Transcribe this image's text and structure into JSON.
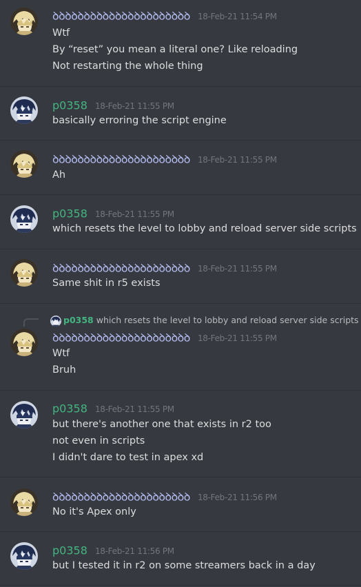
{
  "users": {
    "u1": {
      "name": "ꝺꝺꝺꝺꝺꝺꝺꝺꝺꝺꝺꝺꝺꝺꝺꝺꝺꝺꝺꝺꝺꝺ",
      "color": "#b7bff5",
      "avatar_icon": "golden-hair-avatar-icon"
    },
    "u2": {
      "name": "p0358",
      "color": "#43b581",
      "avatar_icon": "dark-hair-avatar-icon"
    }
  },
  "messages": [
    {
      "author": "ꝺꝺꝺꝺꝺꝺꝺꝺꝺꝺꝺꝺꝺꝺꝺꝺꝺꝺꝺꝺꝺꝺ",
      "timestamp": "18-Feb-21 11:54 PM",
      "lines": [
        "Wtf",
        "By “reset” you mean a literal one? Like reloading",
        "Not restarting the whole thing"
      ]
    },
    {
      "author": "p0358",
      "timestamp": "18-Feb-21 11:55 PM",
      "lines": [
        "basically erroring the script engine"
      ]
    },
    {
      "author": "ꝺꝺꝺꝺꝺꝺꝺꝺꝺꝺꝺꝺꝺꝺꝺꝺꝺꝺꝺꝺꝺꝺ",
      "timestamp": "18-Feb-21 11:55 PM",
      "lines": [
        "Ah"
      ]
    },
    {
      "author": "p0358",
      "timestamp": "18-Feb-21 11:55 PM",
      "lines": [
        "which resets the level to lobby and reload server side scripts"
      ]
    },
    {
      "author": "ꝺꝺꝺꝺꝺꝺꝺꝺꝺꝺꝺꝺꝺꝺꝺꝺꝺꝺꝺꝺꝺꝺ",
      "timestamp": "18-Feb-21 11:55 PM",
      "lines": [
        "Same shit in r5 exists"
      ]
    },
    {
      "reply": {
        "author": "p0358",
        "text": "which resets the level to lobby and reload server side scripts"
      },
      "author": "ꝺꝺꝺꝺꝺꝺꝺꝺꝺꝺꝺꝺꝺꝺꝺꝺꝺꝺꝺꝺꝺꝺ",
      "timestamp": "18-Feb-21 11:55 PM",
      "lines": [
        "Wtf",
        "Bruh"
      ]
    },
    {
      "author": "p0358",
      "timestamp": "18-Feb-21 11:55 PM",
      "lines": [
        "but there's another one that exists in r2 too",
        "not even in scripts",
        "I didn't dare to test in apex xd"
      ]
    },
    {
      "author": "ꝺꝺꝺꝺꝺꝺꝺꝺꝺꝺꝺꝺꝺꝺꝺꝺꝺꝺꝺꝺꝺꝺ",
      "timestamp": "18-Feb-21 11:56 PM",
      "lines": [
        "No it's Apex only"
      ]
    },
    {
      "author": "p0358",
      "timestamp": "18-Feb-21 11:56 PM",
      "lines": [
        "but I tested it in r2 on some streamers back in a day"
      ]
    }
  ]
}
